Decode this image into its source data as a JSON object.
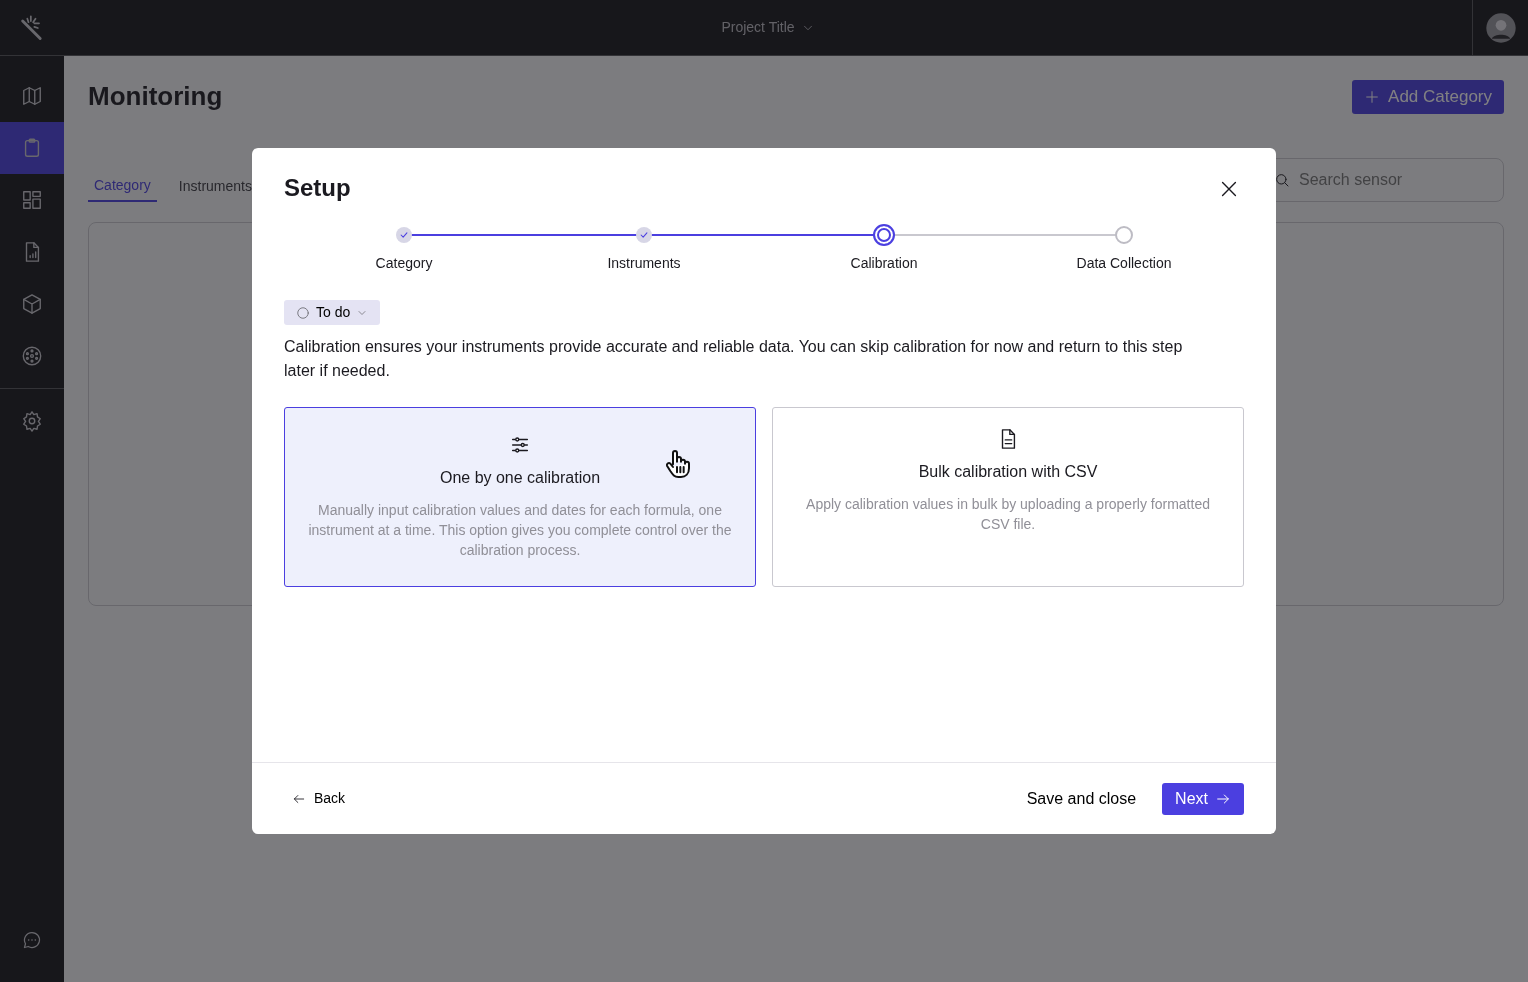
{
  "header": {
    "project_title": "Project Title"
  },
  "sidebar": {
    "items": [
      {
        "kind": "map",
        "selected": false
      },
      {
        "kind": "clipboard",
        "selected": true
      },
      {
        "kind": "dashboard",
        "selected": false
      },
      {
        "kind": "report",
        "selected": false
      },
      {
        "kind": "cube",
        "selected": false
      },
      {
        "kind": "reel",
        "selected": false
      },
      {
        "kind": "gear",
        "selected": false
      }
    ]
  },
  "page": {
    "title": "Monitoring",
    "add_button": "Add Category",
    "tabs": [
      {
        "label": "Category",
        "selected": true
      },
      {
        "label": "Instruments",
        "selected": false
      }
    ],
    "search": {
      "placeholder": "Search sensor"
    }
  },
  "modal": {
    "title": "Setup",
    "steps": [
      {
        "label": "Category",
        "kind": "done"
      },
      {
        "label": "Instruments",
        "kind": "done"
      },
      {
        "label": "Calibration",
        "kind": "current"
      },
      {
        "label": "Data Collection",
        "kind": "todo"
      }
    ],
    "status_pill": "To do",
    "intro": "Calibration ensures your instruments provide accurate and reliable data. You can skip calibration for now and return to this step later if needed.",
    "options": [
      {
        "kind": "sliders",
        "title": "One by one calibration",
        "description": "Manually input calibration values and dates for each formula, one instrument at a time. This option gives you complete control over the calibration process.",
        "selected": true
      },
      {
        "kind": "document",
        "title": "Bulk calibration with CSV",
        "description": "Apply calibration values in bulk by uploading a properly formatted CSV file.",
        "selected": false
      }
    ],
    "back": "Back",
    "save": "Save and close",
    "next": "Next"
  }
}
